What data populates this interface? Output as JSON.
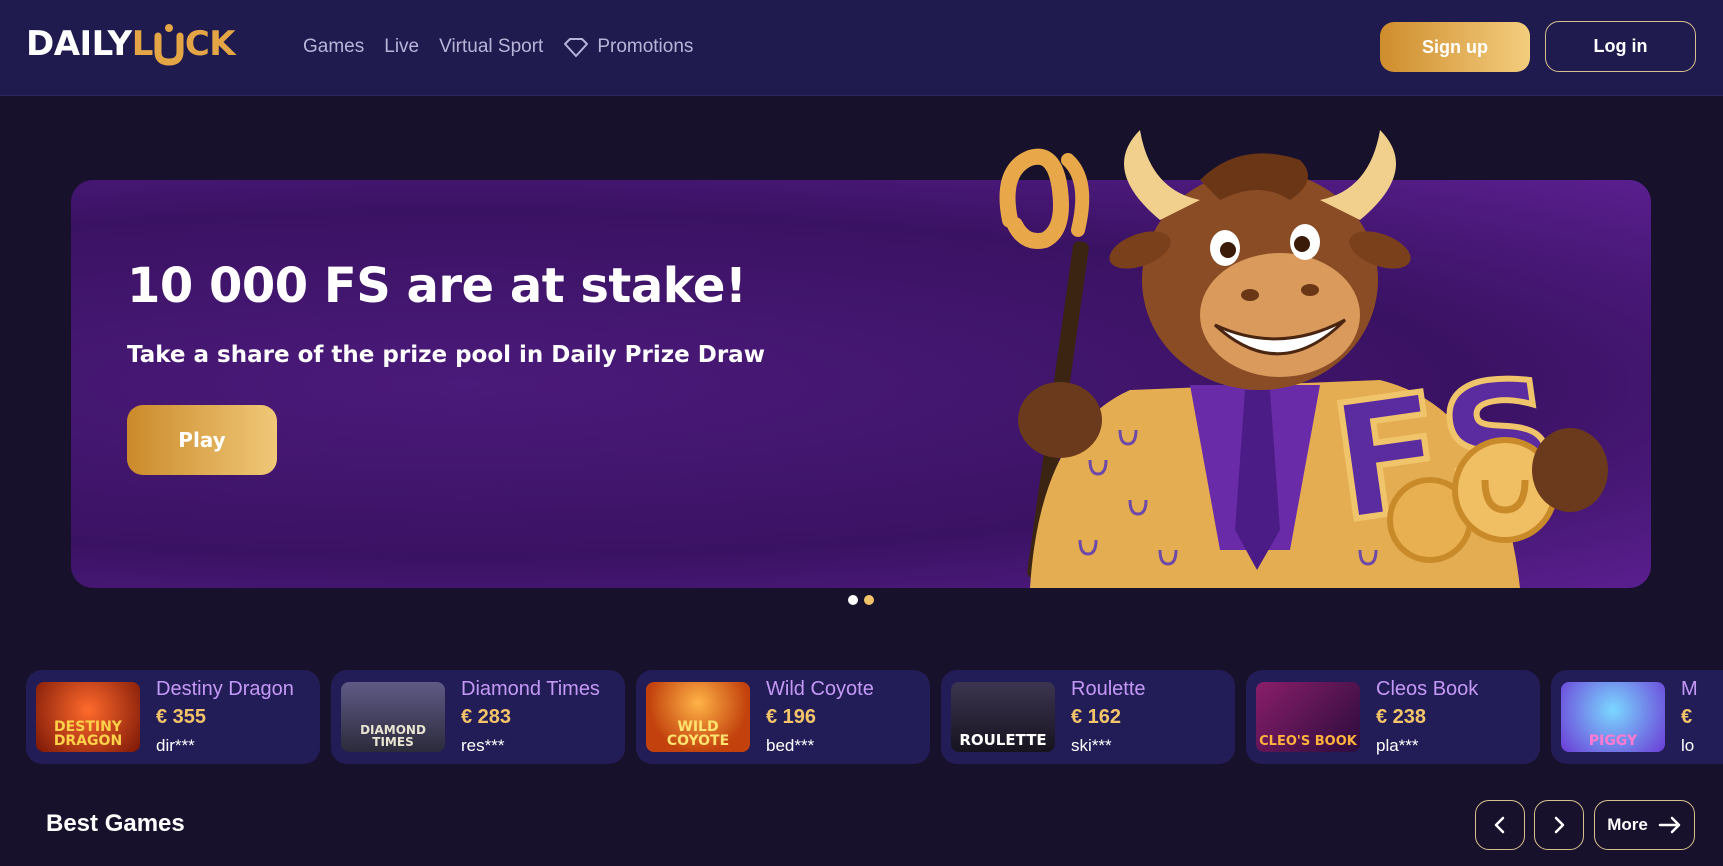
{
  "header": {
    "logo": {
      "part1": "DAILY",
      "part2": "L",
      "part3": "CK"
    },
    "nav": [
      {
        "label": "Games"
      },
      {
        "label": "Live"
      },
      {
        "label": "Virtual Sport"
      },
      {
        "label": "Promotions",
        "icon": "diamond-icon"
      }
    ],
    "signup_label": "Sign up",
    "login_label": "Log in"
  },
  "hero": {
    "title": "10 000 FS are at stake!",
    "subtitle": "Take a share of the prize pool in Daily Prize Draw",
    "play_label": "Play",
    "art_text": "FS",
    "slides": 2,
    "active_slide": 2
  },
  "winners": [
    {
      "game": "Destiny Dragon",
      "amount": "€ 355",
      "user": "dir***",
      "thumb_text": "DESTINY DRAGON"
    },
    {
      "game": "Diamond Times",
      "amount": "€ 283",
      "user": "res***",
      "thumb_text": "DIAMOND TIMES"
    },
    {
      "game": "Wild Coyote",
      "amount": "€ 196",
      "user": "bed***",
      "thumb_text": "WILD COYOTE"
    },
    {
      "game": "Roulette",
      "amount": "€ 162",
      "user": "ski***",
      "thumb_text": "ROULETTE"
    },
    {
      "game": "Cleos Book",
      "amount": "€ 238",
      "user": "pla***",
      "thumb_text": "CLEO'S BOOK"
    },
    {
      "game": "M",
      "amount": "€",
      "user": "lo",
      "thumb_text": "PIGGY"
    }
  ],
  "best_games": {
    "title": "Best Games",
    "more_label": "More"
  },
  "colors": {
    "header_bg": "#201b4e",
    "page_bg": "#17112b",
    "accent_gold": "#e3a545",
    "hero_purple": "#3a1263",
    "game_name": "#c499f5",
    "amount": "#f4c46a"
  }
}
